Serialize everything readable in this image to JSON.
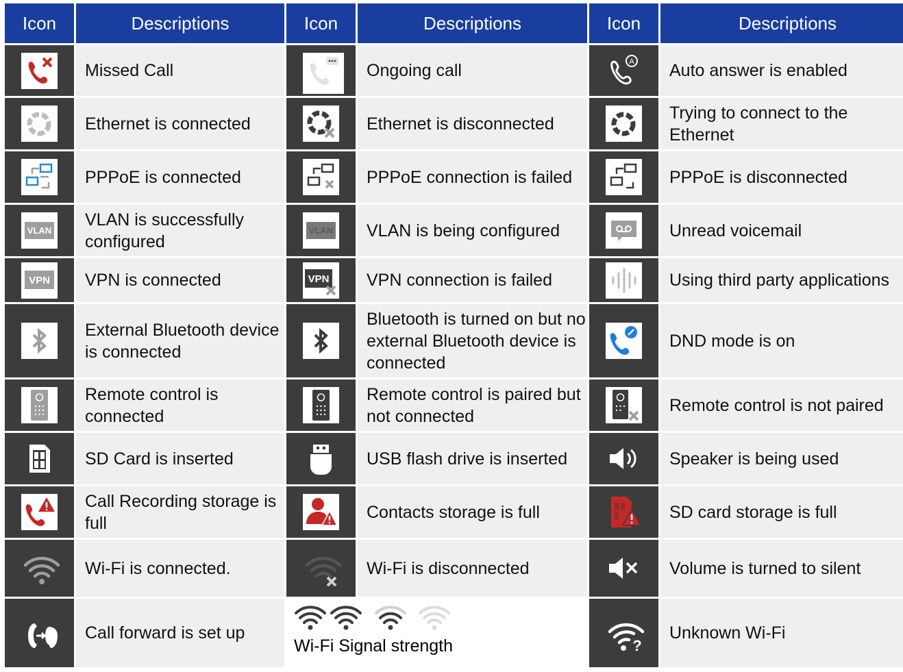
{
  "headers": {
    "icon": "Icon",
    "descriptions": "Descriptions"
  },
  "rows": [
    [
      "Missed Call",
      "Ongoing call",
      "Auto answer is enabled"
    ],
    [
      "Ethernet is connected",
      "Ethernet is disconnected",
      "Trying to connect to the Ethernet"
    ],
    [
      "PPPoE is connected",
      "PPPoE connection is failed",
      "PPPoE is disconnected"
    ],
    [
      "VLAN is successfully configured",
      "VLAN is being configured",
      "Unread voicemail"
    ],
    [
      "VPN is connected",
      "VPN connection is failed",
      "Using third party applications"
    ],
    [
      "External Bluetooth device is connected",
      "Bluetooth is turned on but no external Bluetooth device is connected",
      "DND mode is on"
    ],
    [
      "Remote control is connected",
      "Remote control is paired but not connected",
      "Remote control is not paired"
    ],
    [
      "SD Card is inserted",
      "USB flash drive is inserted",
      "Speaker is being used"
    ],
    [
      "Call Recording storage is full",
      "Contacts storage is full",
      "SD card storage is full"
    ],
    [
      "Wi-Fi is connected.",
      "Wi-Fi is disconnected",
      "Volume is turned to silent"
    ],
    [
      "Call forward is set up",
      "Wi-Fi Signal strength",
      "Unknown Wi-Fi"
    ]
  ],
  "icon_labels": {
    "vlan": "VLAN",
    "vpn": "VPN"
  },
  "icons": [
    [
      "missed-call-icon",
      "ongoing-call-icon",
      "auto-answer-icon"
    ],
    [
      "ethernet-connected-icon",
      "ethernet-disconnected-icon",
      "ethernet-connecting-icon"
    ],
    [
      "pppoe-connected-icon",
      "pppoe-failed-icon",
      "pppoe-disconnected-icon"
    ],
    [
      "vlan-configured-icon",
      "vlan-configuring-icon",
      "voicemail-icon"
    ],
    [
      "vpn-connected-icon",
      "vpn-failed-icon",
      "third-party-app-icon"
    ],
    [
      "bluetooth-device-connected-icon",
      "bluetooth-on-icon",
      "dnd-icon"
    ],
    [
      "remote-connected-icon",
      "remote-paired-icon",
      "remote-not-paired-icon"
    ],
    [
      "sd-card-icon",
      "usb-drive-icon",
      "speaker-icon"
    ],
    [
      "call-recording-full-icon",
      "contacts-full-icon",
      "sd-card-full-icon"
    ],
    [
      "wifi-connected-icon",
      "wifi-disconnected-icon",
      "volume-silent-icon"
    ],
    [
      "call-forward-icon",
      "wifi-signal-strength-icons",
      "unknown-wifi-icon"
    ]
  ],
  "colors": {
    "header_bg": "#1a3ea0",
    "icon_cell_bg": "#3c3c3c",
    "desc_cell_bg": "#efefef",
    "alert_red": "#c62828",
    "accent_blue": "#1e7fd8"
  }
}
